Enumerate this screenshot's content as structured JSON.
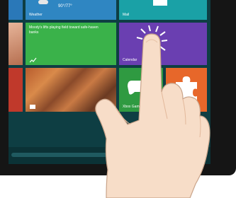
{
  "tiles": {
    "weather": {
      "label": "Weather",
      "temp": "90°/77°"
    },
    "mail": {
      "label": "Mail"
    },
    "news": {
      "headline": "Moody's lifts playing field toward safe-haven banks"
    },
    "calendar": {
      "label": "Calendar"
    },
    "games": {
      "label": "Xbox Games"
    }
  },
  "colors": {
    "background": "#0e3e43",
    "weather": "#2f86c2",
    "mail": "#1aa1a6",
    "news": "#3ab24a",
    "calendar": "#6a3fb1",
    "games": "#2f9a41",
    "store": "#e7672a"
  }
}
